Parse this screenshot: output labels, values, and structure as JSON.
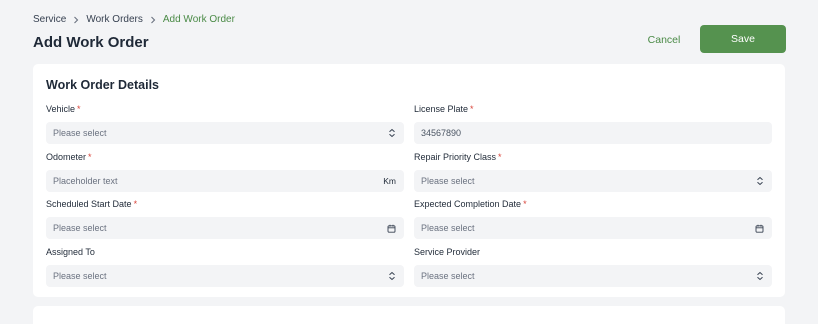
{
  "breadcrumb": {
    "items": [
      {
        "label": "Service"
      },
      {
        "label": "Work Orders"
      },
      {
        "label": "Add Work Order"
      }
    ]
  },
  "header": {
    "title": "Add Work Order",
    "cancel_label": "Cancel",
    "save_label": "Save"
  },
  "form": {
    "section_title": "Work Order Details",
    "required_marker": "*",
    "fields": {
      "vehicle": {
        "label": "Vehicle",
        "required": true,
        "value": "",
        "placeholder": "Please select",
        "icon": "chevron-updown-icon"
      },
      "license_plate": {
        "label": "License Plate",
        "required": true,
        "value": "34567890"
      },
      "odometer": {
        "label": "Odometer",
        "required": true,
        "value": "",
        "placeholder": "Placeholder text",
        "suffix": "Km"
      },
      "repair_priority": {
        "label": "Repair Priority Class",
        "required": true,
        "value": "",
        "placeholder": "Please select",
        "icon": "chevron-updown-icon"
      },
      "scheduled_start": {
        "label": "Scheduled Start Date",
        "required": true,
        "value": "",
        "placeholder": "Please select",
        "icon": "calendar-icon"
      },
      "expected_completion": {
        "label": "Expected Completion Date",
        "required": true,
        "value": "",
        "placeholder": "Please select",
        "icon": "calendar-icon"
      },
      "assigned_to": {
        "label": "Assigned To",
        "required": false,
        "value": "",
        "placeholder": "Please select",
        "icon": "chevron-updown-icon"
      },
      "service_provider": {
        "label": "Service Provider",
        "required": false,
        "value": "",
        "placeholder": "Please select",
        "icon": "chevron-updown-icon"
      }
    }
  },
  "colors": {
    "accent": "#55924f",
    "accent_text": "#4a8a46",
    "required": "#d9443a",
    "background": "#f3f4f6",
    "card": "#ffffff"
  }
}
